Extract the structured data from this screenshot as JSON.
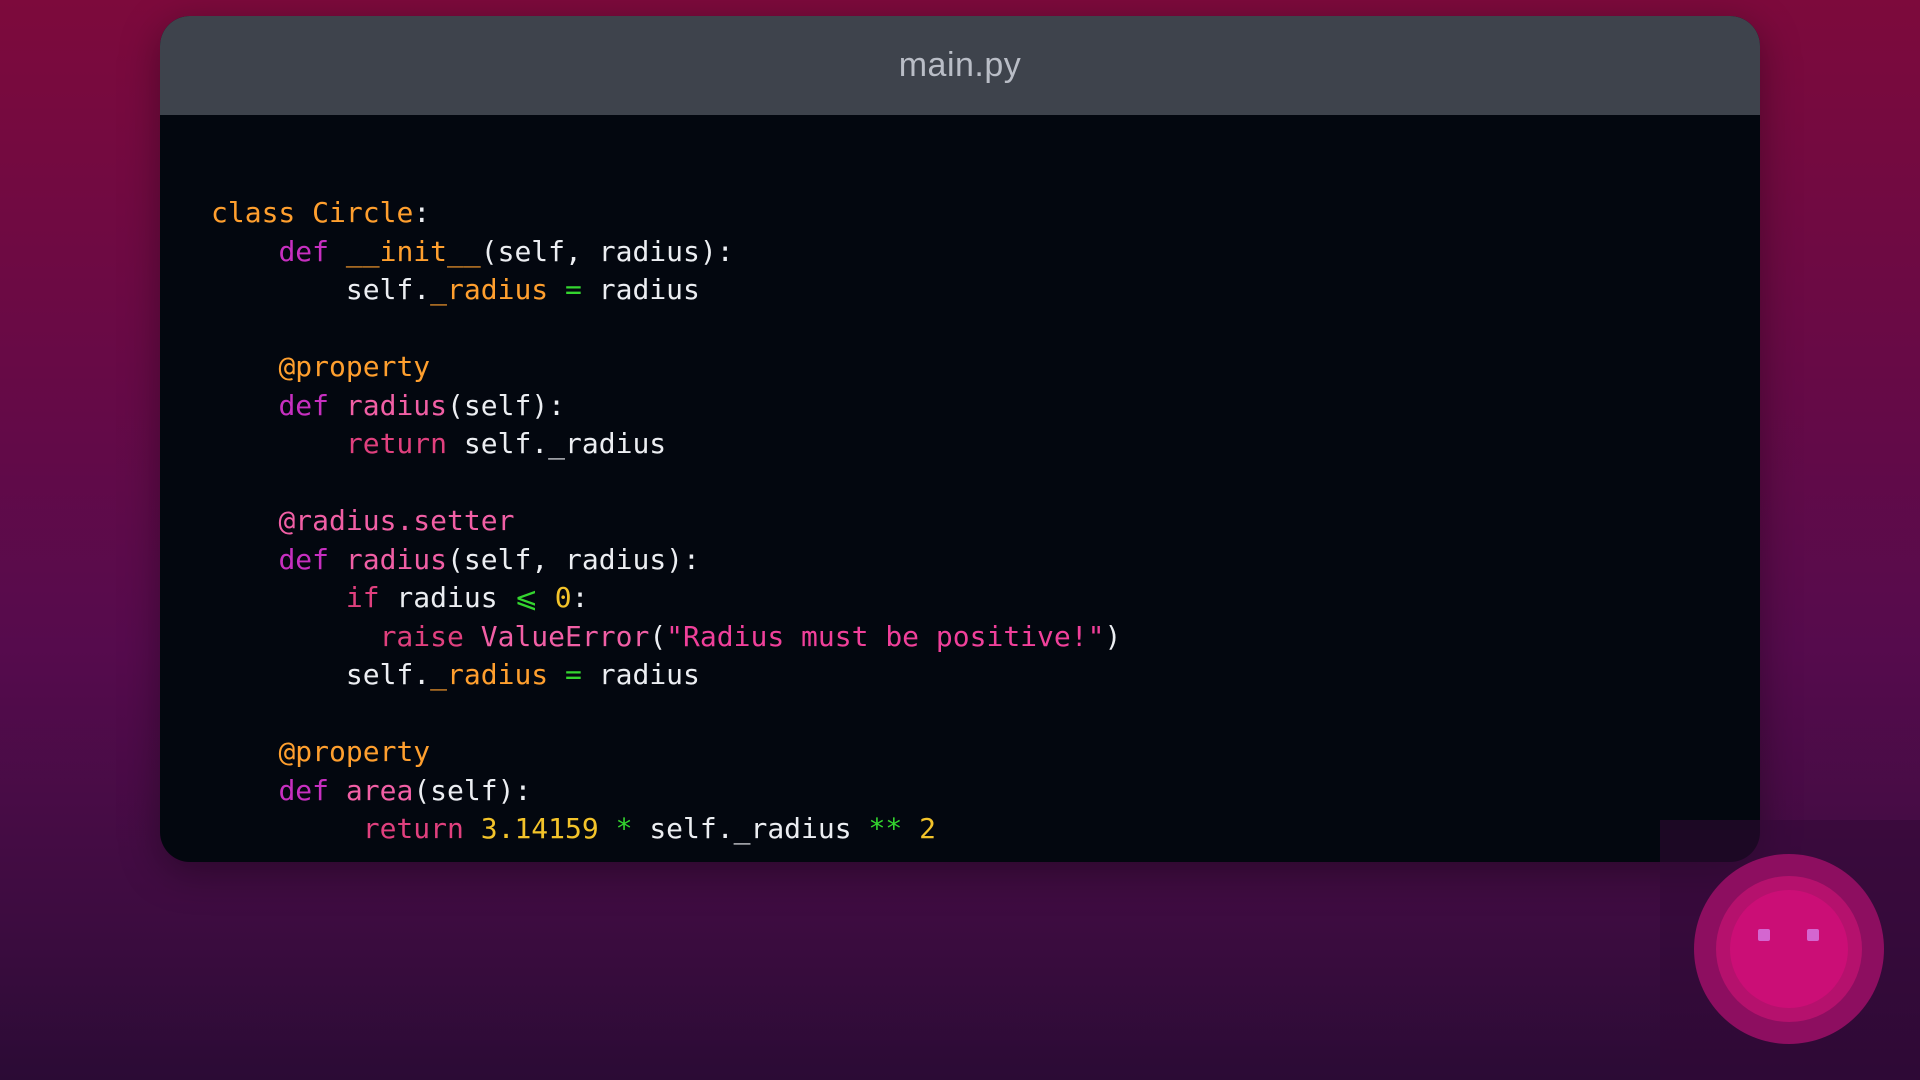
{
  "window": {
    "title": "main.py"
  },
  "code": {
    "lines": [
      [
        {
          "t": "class",
          "c": "kw"
        },
        {
          "t": " ",
          "c": "tx"
        },
        {
          "t": "Circle",
          "c": "kw"
        },
        {
          "t": ":",
          "c": "tx"
        }
      ],
      [
        {
          "t": "    ",
          "c": "tx"
        },
        {
          "t": "def",
          "c": "def"
        },
        {
          "t": " ",
          "c": "tx"
        },
        {
          "t": "__init__",
          "c": "attr"
        },
        {
          "t": "(self, radius):",
          "c": "tx"
        }
      ],
      [
        {
          "t": "        self.",
          "c": "tx"
        },
        {
          "t": "_radius",
          "c": "attr"
        },
        {
          "t": " ",
          "c": "tx"
        },
        {
          "t": "=",
          "c": "op"
        },
        {
          "t": " radius",
          "c": "tx"
        }
      ],
      [],
      [
        {
          "t": "    ",
          "c": "tx"
        },
        {
          "t": "@property",
          "c": "deco"
        }
      ],
      [
        {
          "t": "    ",
          "c": "tx"
        },
        {
          "t": "def",
          "c": "def"
        },
        {
          "t": " ",
          "c": "tx"
        },
        {
          "t": "radius",
          "c": "fn"
        },
        {
          "t": "(self):",
          "c": "tx"
        }
      ],
      [
        {
          "t": "        ",
          "c": "tx"
        },
        {
          "t": "return",
          "c": "ret"
        },
        {
          "t": " self._radius",
          "c": "tx"
        }
      ],
      [],
      [
        {
          "t": "    ",
          "c": "tx"
        },
        {
          "t": "@radius.setter",
          "c": "deco2"
        }
      ],
      [
        {
          "t": "    ",
          "c": "tx"
        },
        {
          "t": "def",
          "c": "def"
        },
        {
          "t": " ",
          "c": "tx"
        },
        {
          "t": "radius",
          "c": "fn"
        },
        {
          "t": "(self, radius):",
          "c": "tx"
        }
      ],
      [
        {
          "t": "        ",
          "c": "tx"
        },
        {
          "t": "if",
          "c": "ret"
        },
        {
          "t": " radius ",
          "c": "tx"
        },
        {
          "t": "⩽",
          "c": "op"
        },
        {
          "t": " ",
          "c": "tx"
        },
        {
          "t": "0",
          "c": "num"
        },
        {
          "t": ":",
          "c": "tx"
        }
      ],
      [
        {
          "t": "          ",
          "c": "tx"
        },
        {
          "t": "raise",
          "c": "ret"
        },
        {
          "t": " ",
          "c": "tx"
        },
        {
          "t": "ValueError",
          "c": "fn"
        },
        {
          "t": "(",
          "c": "tx"
        },
        {
          "t": "\"Radius must be positive!\"",
          "c": "str"
        },
        {
          "t": ")",
          "c": "tx"
        }
      ],
      [
        {
          "t": "        self.",
          "c": "tx"
        },
        {
          "t": "_radius",
          "c": "attr"
        },
        {
          "t": " ",
          "c": "tx"
        },
        {
          "t": "=",
          "c": "op"
        },
        {
          "t": " radius",
          "c": "tx"
        }
      ],
      [],
      [
        {
          "t": "    ",
          "c": "tx"
        },
        {
          "t": "@property",
          "c": "deco"
        }
      ],
      [
        {
          "t": "    ",
          "c": "tx"
        },
        {
          "t": "def",
          "c": "def"
        },
        {
          "t": " ",
          "c": "tx"
        },
        {
          "t": "area",
          "c": "fn"
        },
        {
          "t": "(self):",
          "c": "tx"
        }
      ],
      [
        {
          "t": "         ",
          "c": "tx"
        },
        {
          "t": "return",
          "c": "ret"
        },
        {
          "t": " ",
          "c": "tx"
        },
        {
          "t": "3.14159",
          "c": "num"
        },
        {
          "t": " ",
          "c": "tx"
        },
        {
          "t": "*",
          "c": "op"
        },
        {
          "t": " self._radius ",
          "c": "tx"
        },
        {
          "t": "**",
          "c": "op"
        },
        {
          "t": " ",
          "c": "tx"
        },
        {
          "t": "2",
          "c": "num"
        }
      ]
    ]
  },
  "colors": {
    "keyword": "#ff9f2e",
    "def": "#c72fc0",
    "function": "#f15fa5",
    "operator": "#34d52f",
    "number": "#f3c32a",
    "string": "#f0409a",
    "text": "#eceef2",
    "titlebar": "#3e434c",
    "editor_bg": "#03070f"
  },
  "avatar": {
    "icon": "robot-face-icon"
  }
}
